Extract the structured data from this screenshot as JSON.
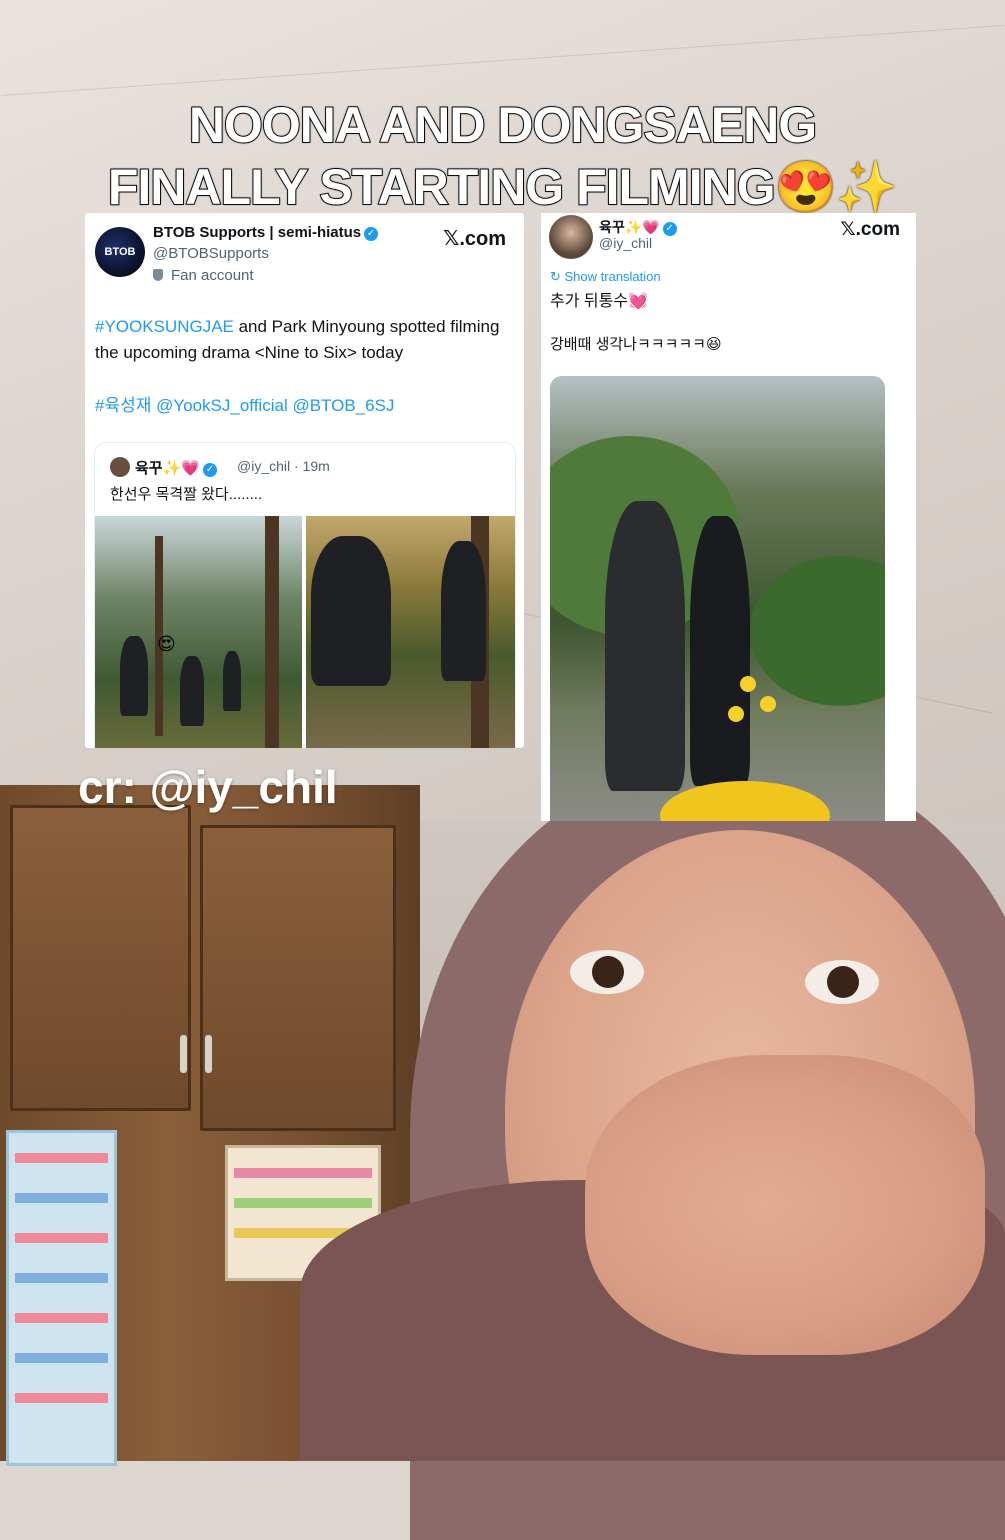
{
  "headline": {
    "line1": "NOONA AND DONGSAENG",
    "line2": "FINALLY STARTING FILMING😍✨"
  },
  "credit": "cr: @iy_chil",
  "tweet1": {
    "name": "BTOB Supports | semi-hiatus",
    "handle": "@BTOBSupports",
    "badge": "Fan account",
    "source": "𝕏.com",
    "avatar_text": "BTOB",
    "body_hashtag": "#YOOKSUNGJAE",
    "body_text": " and Park Minyoung spotted filming the upcoming drama <Nine to Six> today",
    "tags": "#육성재 @YookSJ_official @BTOB_6SJ",
    "quote": {
      "name": "육꾸✨💗",
      "handle_time": "@iy_chil · 19m",
      "text": "한선우 목격짤 왔다........",
      "emoji": "😍"
    }
  },
  "tweet2": {
    "name": "육꾸✨💗",
    "handle": "@iy_chil",
    "source": "𝕏.com",
    "translate": "Show translation",
    "line1": "추가 뒤통수💓",
    "line2": "강배때 생각나ㅋㅋㅋㅋㅋ😆"
  },
  "colors": {
    "link": "#1d9bf0",
    "verified": "#1d9bf0"
  }
}
